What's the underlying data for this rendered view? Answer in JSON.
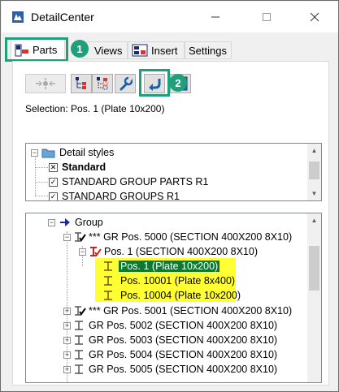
{
  "window": {
    "title": "DetailCenter"
  },
  "tabs": [
    {
      "label": "Parts",
      "active": true
    },
    {
      "label": "Views",
      "active": false
    },
    {
      "label": "Insert",
      "active": false
    },
    {
      "label": "Settings",
      "active": false
    }
  ],
  "callouts": {
    "one": "1",
    "two": "2"
  },
  "selection": {
    "text": "Selection: Pos. 1 (Plate 10x200)"
  },
  "detail_styles": {
    "root": "Detail styles",
    "items": [
      "Standard",
      "STANDARD GROUP PARTS R1",
      "STANDARD GROUPS R1"
    ]
  },
  "tree": {
    "root": "Group",
    "group1": "*** GR Pos. 5000 (SECTION 400X200 8X10)",
    "pos1": "Pos. 1 (SECTION 400X200 8X10)",
    "children": [
      "Pos. 1 (Plate 10x200)",
      "Pos. 10001 (Plate 8x400)",
      "Pos. 10004 (Plate 10x200)"
    ],
    "groups": [
      "*** GR Pos. 5001 (SECTION 400X200 8X10)",
      "GR Pos. 5002 (SECTION 400X200 8X10)",
      "GR Pos. 5003 (SECTION 400X200 8X10)",
      "GR Pos. 5004 (SECTION 400X200 8X10)",
      "GR Pos. 5005 (SECTION 400X200 8X10)"
    ]
  },
  "colors": {
    "accent": "#1fa07a",
    "highlight": "#ffff33",
    "selected": "#0b7a2e"
  }
}
